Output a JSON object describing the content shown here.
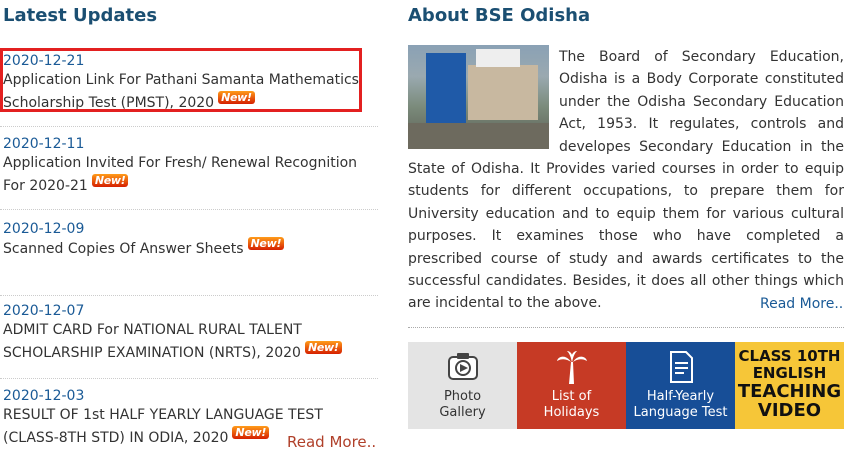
{
  "latest": {
    "heading": "Latest Updates",
    "items": [
      {
        "date": "2020-12-21",
        "title": "Application Link For Pathani Samanta Mathematics Scholarship Test (PMST), 2020",
        "badge": "New!"
      },
      {
        "date": "2020-12-11",
        "title": "Application Invited For Fresh/ Renewal Recognition For 2020-21",
        "badge": "New!"
      },
      {
        "date": "2020-12-09",
        "title": "Scanned Copies Of Answer Sheets",
        "badge": "New!"
      },
      {
        "date": "2020-12-07",
        "title": "ADMIT CARD For NATIONAL RURAL TALENT SCHOLARSHIP EXAMINATION (NRTS), 2020",
        "badge": "New!"
      },
      {
        "date": "2020-12-03",
        "title": "RESULT OF 1st HALF YEARLY LANGUAGE TEST (CLASS-8TH STD) IN ODIA, 2020",
        "badge": "New!"
      }
    ],
    "read_more": "Read More.."
  },
  "about": {
    "heading": "About BSE Odisha",
    "text": "The Board of Secondary Education, Odisha is a Body Corporate constituted under the Odisha Secondary Education Act, 1953. It regulates, controls and developes Secondary Education in the State of Odisha. It Provides varied courses in order to equip students for different occupations, to prepare them for University education and to equip them for various cultural purposes. It examines those who have completed a prescribed course of study and awards certificates to the successful candidates. Besides, it does all other things which are incidental to the above.",
    "read_more": "Read More.."
  },
  "tiles": {
    "photo_gallery": {
      "line1": "Photo",
      "line2": "Gallery",
      "color": "#e4e4e4"
    },
    "holidays": {
      "line1": "List of",
      "line2": "Holidays",
      "color": "#c63a25"
    },
    "half_yearly": {
      "line1": "Half-Yearly",
      "line2": "Language Test",
      "color": "#174e97"
    },
    "video": {
      "line1": "CLASS 10TH",
      "line2": "ENGLISH",
      "line3": "TEACHING",
      "line4": "VIDEO",
      "color": "#f6c638"
    }
  }
}
